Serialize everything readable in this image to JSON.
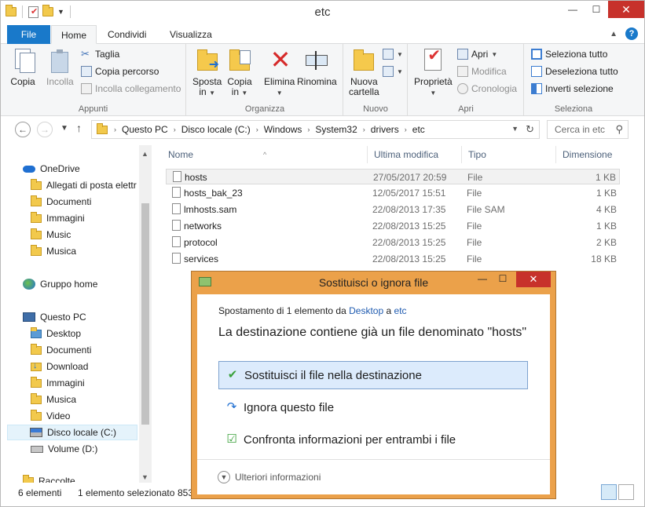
{
  "window": {
    "title": "etc"
  },
  "ribbon": {
    "tabs": {
      "file": "File",
      "home": "Home",
      "share": "Condividi",
      "view": "Visualizza"
    },
    "appunti": {
      "label": "Appunti",
      "copia": "Copia",
      "incolla": "Incolla",
      "taglia": "Taglia",
      "copia_percorso": "Copia percorso",
      "incolla_collegamento": "Incolla collegamento"
    },
    "organizza": {
      "label": "Organizza",
      "sposta_l1": "Sposta",
      "sposta_l2": "in",
      "copia_l1": "Copia",
      "copia_l2": "in",
      "elimina": "Elimina",
      "rinomina": "Rinomina"
    },
    "nuovo": {
      "label": "Nuovo",
      "nuova_l1": "Nuova",
      "nuova_l2": "cartella"
    },
    "apri": {
      "label": "Apri",
      "proprieta": "Proprietà",
      "apri": "Apri",
      "modifica": "Modifica",
      "cronologia": "Cronologia"
    },
    "seleziona": {
      "label": "Seleziona",
      "tutto": "Seleziona tutto",
      "deseleziona": "Deseleziona tutto",
      "inverti": "Inverti selezione"
    }
  },
  "address": {
    "crumbs": [
      "Questo PC",
      "Disco locale (C:)",
      "Windows",
      "System32",
      "drivers",
      "etc"
    ],
    "search_placeholder": "Cerca in etc"
  },
  "nav": {
    "onedrive": "OneDrive",
    "allegati": "Allegati di posta elettr",
    "documenti": "Documenti",
    "immagini": "Immagini",
    "music": "Music",
    "musica": "Musica",
    "gruppo_home": "Gruppo home",
    "questo_pc": "Questo PC",
    "desktop": "Desktop",
    "pc_documenti": "Documenti",
    "download": "Download",
    "pc_immagini": "Immagini",
    "pc_musica": "Musica",
    "video": "Video",
    "disco_c": "Disco locale (C:)",
    "volume_d": "Volume (D:)",
    "raccolte": "Raccolte"
  },
  "filelist": {
    "columns": {
      "name": "Nome",
      "modified": "Ultima modifica",
      "type": "Tipo",
      "size": "Dimensione"
    },
    "rows": [
      {
        "name": "hosts",
        "modified": "27/05/2017 20:59",
        "type": "File",
        "size": "1 KB"
      },
      {
        "name": "hosts_bak_23",
        "modified": "12/05/2017 15:51",
        "type": "File",
        "size": "1 KB"
      },
      {
        "name": "lmhosts.sam",
        "modified": "22/08/2013 17:35",
        "type": "File SAM",
        "size": "4 KB"
      },
      {
        "name": "networks",
        "modified": "22/08/2013 15:25",
        "type": "File",
        "size": "1 KB"
      },
      {
        "name": "protocol",
        "modified": "22/08/2013 15:25",
        "type": "File",
        "size": "2 KB"
      },
      {
        "name": "services",
        "modified": "22/08/2013 15:25",
        "type": "File",
        "size": "18 KB"
      }
    ]
  },
  "status": {
    "count": "6 elementi",
    "selected": "1 elemento selezionato",
    "size": "853"
  },
  "dialog": {
    "title": "Sostituisci o ignora file",
    "sub_prefix": "Spostamento di 1 elemento da",
    "sub_from": "Desktop",
    "sub_mid": "a",
    "sub_to": "etc",
    "main": "La destinazione contiene già un file denominato \"hosts\"",
    "opt_replace": "Sostituisci il file nella destinazione",
    "opt_skip": "Ignora questo file",
    "opt_compare": "Confronta informazioni per entrambi i file",
    "more": "Ulteriori informazioni"
  }
}
